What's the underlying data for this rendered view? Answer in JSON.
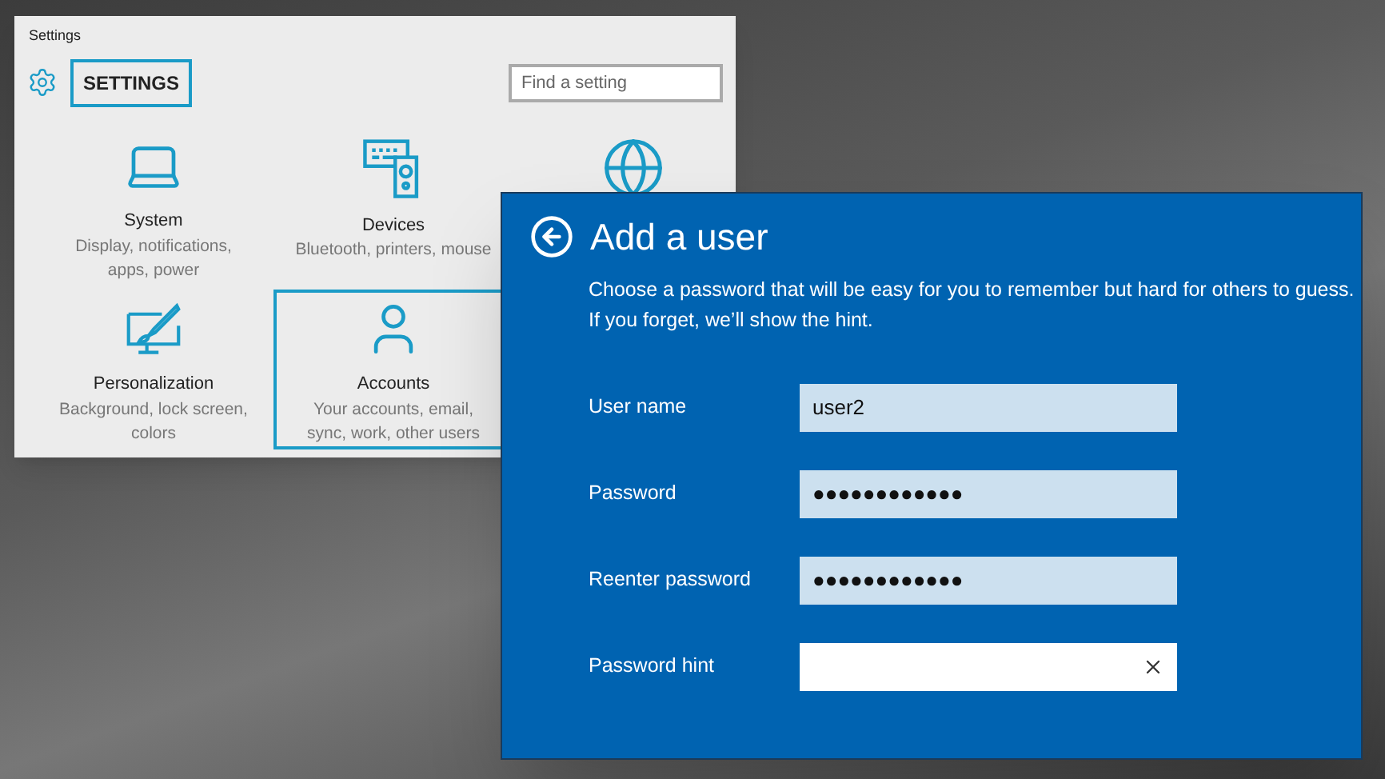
{
  "settings_window": {
    "title": "Settings",
    "header": {
      "label": "SETTINGS",
      "highlighted": true
    },
    "search": {
      "placeholder": "Find a setting"
    },
    "tiles": [
      {
        "kind": "system",
        "label": "System",
        "description": "Display, notifications, apps, power",
        "selected": false
      },
      {
        "kind": "devices",
        "label": "Devices",
        "description": "Bluetooth, printers, mouse",
        "selected": false
      },
      {
        "kind": "network",
        "selected": false
      },
      {
        "kind": "personalization",
        "label": "Personalization",
        "description": "Background, lock screen, colors",
        "selected": false
      },
      {
        "kind": "accounts",
        "label": "Accounts",
        "description": "Your accounts, email, sync, work, other users",
        "selected": true
      }
    ]
  },
  "dialog": {
    "title": "Add a user",
    "description": "Choose a password that will be easy for you to remember but hard for others to guess. If you forget, we’ll show the hint.",
    "fields": [
      {
        "label": "User name",
        "value": "user2",
        "focused": false
      },
      {
        "label": "Password",
        "value": "●●●●●●●●●●●●",
        "focused": false
      },
      {
        "label": "Reenter password",
        "value": "●●●●●●●●●●●●",
        "focused": false
      },
      {
        "label": "Password hint",
        "focused": true
      }
    ]
  }
}
